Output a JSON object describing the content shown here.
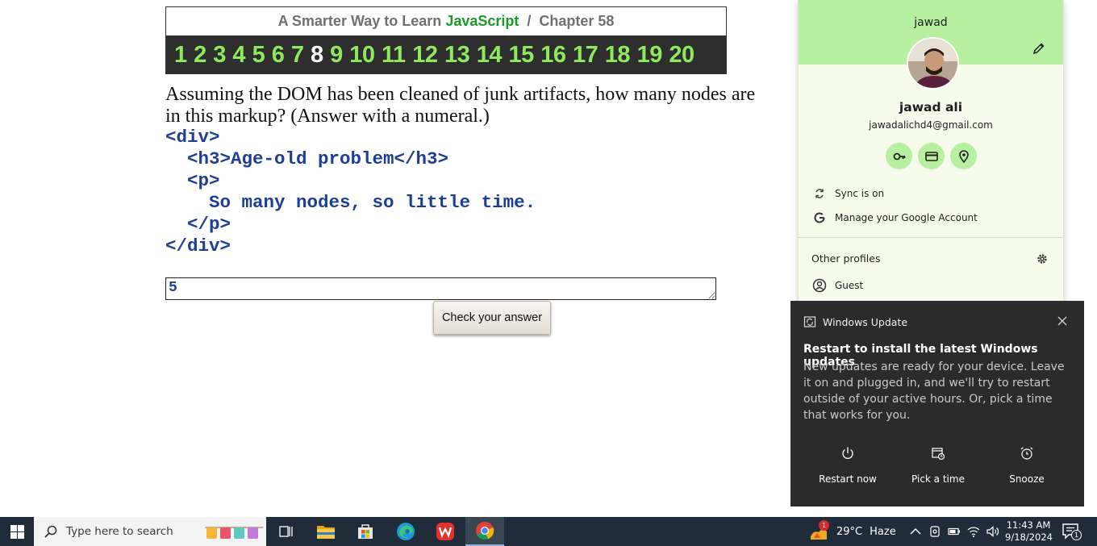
{
  "header": {
    "title_prefix": "A Smarter Way to Learn ",
    "title_js": "JavaScript",
    "title_suffix": "  /  Chapter 58",
    "chapters": [
      "1",
      "2",
      "3",
      "4",
      "5",
      "6",
      "7",
      "8",
      "9",
      "10",
      "11",
      "12",
      "13",
      "14",
      "15",
      "16",
      "17",
      "18",
      "19",
      "20"
    ],
    "active_chapter": "8"
  },
  "lesson": {
    "question_line1": "Assuming the DOM has been cleaned of junk artifacts, how many nodes are",
    "question_line2": "in this markup? (Answer with a numeral.)",
    "code_lines": [
      "<div>",
      "  <h3>Age-old problem</h3>",
      "  <p>",
      "    So many nodes, so little time.",
      "  </p>",
      "</div>"
    ],
    "answer_value": "5",
    "check_button": "Check your answer"
  },
  "profile": {
    "profile_name": "jawad",
    "full_name": "jawad ali",
    "email": "jawadalichd4@gmail.com",
    "sync_label": "Sync is on",
    "manage_label": "Manage your Google Account",
    "other_profiles_label": "Other profiles",
    "guest_label": "Guest",
    "accent_color": "#b6f0a0"
  },
  "toast": {
    "app_name": "Windows Update",
    "title": "Restart to install the latest Windows updates",
    "body": "New updates are ready for your device. Leave it on and plugged in, and we'll try to restart outside of your active hours. Or, pick a time that works for you.",
    "actions": [
      "Restart now",
      "Pick a time",
      "Snooze"
    ]
  },
  "taskbar": {
    "search_placeholder": "Type here to search",
    "weather_badge": "1",
    "temperature": "29°C",
    "weather_text": "Haze",
    "time": "11:43 AM",
    "date": "9/18/2024",
    "notification_count": "1"
  }
}
